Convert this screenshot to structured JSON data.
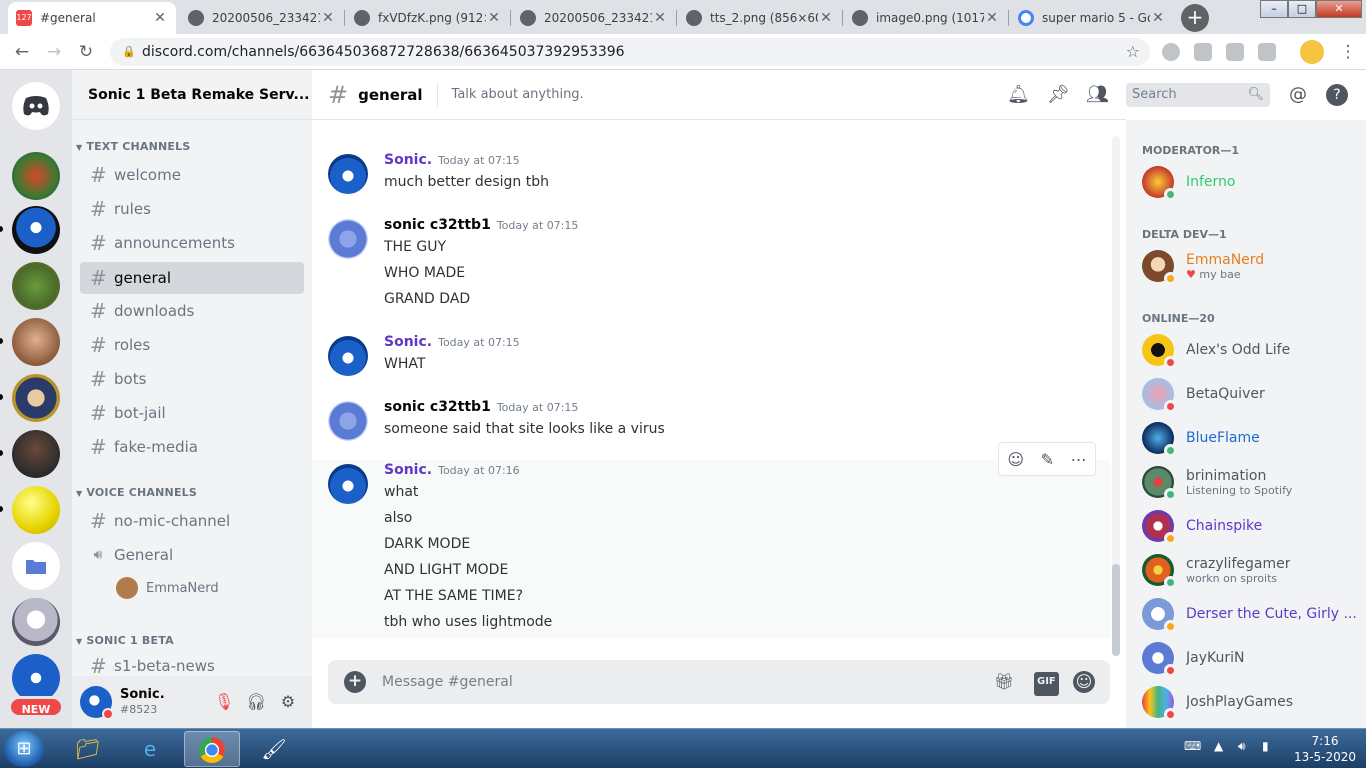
{
  "browser": {
    "tabs": [
      {
        "title": "#general",
        "active": true
      },
      {
        "title": "20200506_233421.p",
        "active": false
      },
      {
        "title": "fxVDfzK.png (912×",
        "active": false
      },
      {
        "title": "20200506_233421.p",
        "active": false
      },
      {
        "title": "tts_2.png (856×607",
        "active": false
      },
      {
        "title": "image0.png (1017×",
        "active": false
      },
      {
        "title": "super mario 5 - Goo",
        "active": false
      }
    ],
    "tab_badge": "127",
    "url": "discord.com/channels/663645036872728638/663645037392953396"
  },
  "guild": {
    "name": "Sonic 1 Beta Remake Serv..."
  },
  "sidebar": {
    "categories": {
      "text": "TEXT CHANNELS",
      "voice": "VOICE CHANNELS",
      "beta": "SONIC 1 BETA"
    },
    "text_channels": [
      "welcome",
      "rules",
      "announcements",
      "general",
      "downloads",
      "roles",
      "bots",
      "bot-jail",
      "fake-media"
    ],
    "voice_channels": [
      "no-mic-channel",
      "General"
    ],
    "voice_user": "EmmaNerd",
    "beta_channels": [
      "s1-beta-news"
    ],
    "new_badge": "NEW"
  },
  "user": {
    "name": "Sonic.",
    "tag": "#8523"
  },
  "channel": {
    "name": "general",
    "topic": "Talk about anything.",
    "search_placeholder": "Search",
    "composer_placeholder": "Message #general",
    "gif_label": "GIF"
  },
  "messages": [
    {
      "author": "Sonic.",
      "color": "#5f38c9",
      "time": "Today at 07:15",
      "lines": [
        "much better design tbh"
      ]
    },
    {
      "author": "sonic c32ttb1",
      "color": "#060607",
      "time": "Today at 07:15",
      "lines": [
        "THE GUY",
        "WHO MADE",
        "GRAND DAD"
      ]
    },
    {
      "author": "Sonic.",
      "color": "#5f38c9",
      "time": "Today at 07:15",
      "lines": [
        "WHAT"
      ]
    },
    {
      "author": "sonic c32ttb1",
      "color": "#060607",
      "time": "Today at 07:15",
      "lines": [
        "someone said that site looks like a virus"
      ]
    },
    {
      "author": "Sonic.",
      "color": "#5f38c9",
      "time": "Today at 07:16",
      "lines": [
        "what",
        "also",
        "DARK MODE",
        "AND LIGHT MODE",
        "AT THE SAME TIME?",
        "tbh who uses lightmode"
      ]
    }
  ],
  "members": {
    "groups": [
      {
        "title": "MODERATOR—1"
      },
      {
        "title": "DELTA DEV—1"
      },
      {
        "title": "ONLINE—20"
      }
    ],
    "list": [
      {
        "name": "Inferno",
        "color": "#2ecc71",
        "status": "mobile",
        "sub": ""
      },
      {
        "name": "EmmaNerd",
        "color": "#e67e22",
        "status": "idle",
        "sub": "my bae"
      },
      {
        "name": "Alex's Odd Life",
        "color": "#4f5660",
        "status": "dnd",
        "sub": ""
      },
      {
        "name": "BetaQuiver",
        "color": "#4f5660",
        "status": "dnd",
        "sub": ""
      },
      {
        "name": "BlueFlame",
        "color": "#1f6bd1",
        "status": "mobile",
        "sub": ""
      },
      {
        "name": "brinimation",
        "color": "#4f5660",
        "status": "online",
        "sub": "Listening to Spotify"
      },
      {
        "name": "Chainspike",
        "color": "#5f38c9",
        "status": "idle",
        "sub": ""
      },
      {
        "name": "crazylifegamer",
        "color": "#4f5660",
        "status": "online",
        "sub": "workn on sproits"
      },
      {
        "name": "Derser the Cute, Girly ...",
        "color": "#5f38c9",
        "status": "idle",
        "sub": ""
      },
      {
        "name": "JayKuriN",
        "color": "#4f5660",
        "status": "dnd",
        "sub": ""
      },
      {
        "name": "JoshPlayGames",
        "color": "#4f5660",
        "status": "dnd",
        "sub": ""
      }
    ]
  },
  "taskbar": {
    "time": "7:16",
    "date": "13-5-2020"
  }
}
